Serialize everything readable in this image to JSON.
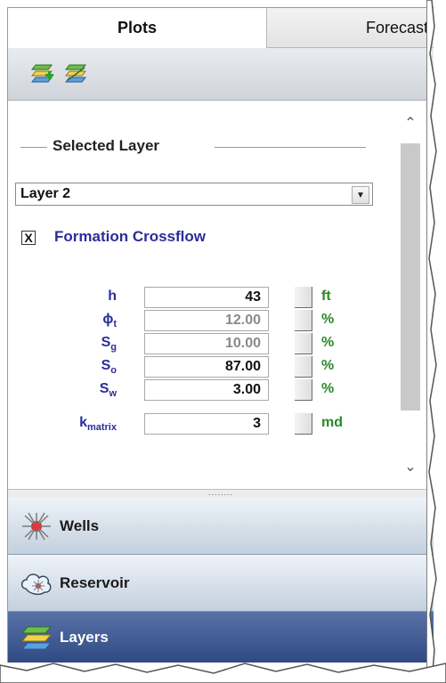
{
  "tabs": {
    "plots": "Plots",
    "forecast": "Forecast"
  },
  "toolbar": {
    "add_icon": "add-layer-icon",
    "remove_icon": "remove-layer-icon"
  },
  "selected_layer": {
    "title": "Selected Layer",
    "value": "Layer 2"
  },
  "formation_crossflow": {
    "label": "Formation Crossflow",
    "checked": true,
    "mark": "X"
  },
  "params": {
    "h": {
      "label": "h",
      "value": "43",
      "unit": "ft"
    },
    "phi": {
      "label": "ϕ",
      "sub": "t",
      "value": "12.00",
      "unit": "%"
    },
    "sg": {
      "label": "S",
      "sub": "g",
      "value": "10.00",
      "unit": "%"
    },
    "so": {
      "label": "S",
      "sub": "o",
      "value": "87.00",
      "unit": "%"
    },
    "sw": {
      "label": "S",
      "sub": "w",
      "value": "3.00",
      "unit": "%"
    },
    "kmatrix": {
      "label": "k",
      "sub": "matrix",
      "value": "3",
      "unit": "md"
    }
  },
  "splitter_grip": "........",
  "nav": {
    "wells": "Wells",
    "reservoir": "Reservoir",
    "layers": "Layers"
  },
  "colors": {
    "label_blue": "#2a2d9a",
    "unit_green": "#2a8a2a",
    "selected_nav": "#3d5893"
  }
}
